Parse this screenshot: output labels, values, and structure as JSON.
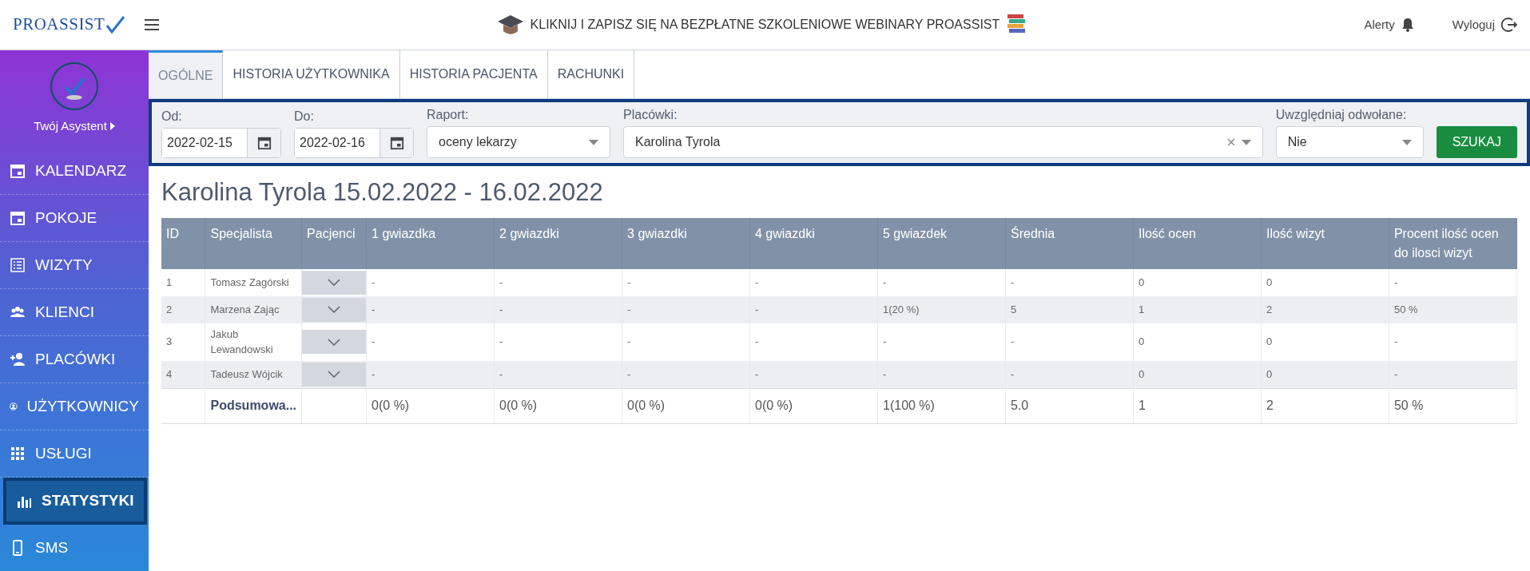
{
  "header": {
    "logo": "PROASSIST",
    "banner": "KLIKNIJ I ZAPISZ SIĘ NA BEZPŁATNE SZKOLENIOWE WEBINARY PROASSIST",
    "alerts": "Alerty",
    "logout": "Wyloguj"
  },
  "sidebar": {
    "user": "Twój Asystent",
    "items": [
      {
        "label": "KALENDARZ",
        "selected": false
      },
      {
        "label": "POKOJE",
        "selected": false
      },
      {
        "label": "WIZYTY",
        "selected": false
      },
      {
        "label": "KLIENCI",
        "selected": false
      },
      {
        "label": "PLACÓWKI",
        "selected": false
      },
      {
        "label": "UŻYTKOWNICY",
        "selected": false
      },
      {
        "label": "USŁUGI",
        "selected": false
      },
      {
        "label": "STATYSTYKI",
        "selected": true
      },
      {
        "label": "SMS",
        "selected": false
      }
    ]
  },
  "tabs": [
    {
      "label": "OGÓLNE",
      "selected": true
    },
    {
      "label": "HISTORIA UŻYTKOWNIKA",
      "selected": false
    },
    {
      "label": "HISTORIA PACJENTA",
      "selected": false
    },
    {
      "label": "RACHUNKI",
      "selected": false
    }
  ],
  "filters": {
    "from": {
      "label": "Od:",
      "value": "2022-02-15"
    },
    "to": {
      "label": "Do:",
      "value": "2022-02-16"
    },
    "report": {
      "label": "Raport:",
      "value": "oceny lekarzy"
    },
    "places": {
      "label": "Placówki:",
      "value": "Karolina Tyrola"
    },
    "cancelled": {
      "label": "Uwzględniaj odwołane:",
      "value": "Nie"
    },
    "search_button": "SZUKAJ"
  },
  "title": "Karolina Tyrola 15.02.2022 - 16.02.2022",
  "table": {
    "columns": [
      "ID",
      "Specjalista",
      "Pacjenci",
      "1 gwiazdka",
      "2 gwiazdki",
      "3 gwiazdki",
      "4 gwiazdki",
      "5 gwiazdek",
      "Średnia",
      "Ilość ocen",
      "Ilość wizyt",
      "Procent ilość ocen do ilosci wizyt"
    ],
    "rows": [
      {
        "cells": [
          "1",
          "Tomasz Zagórski",
          "",
          "-",
          "-",
          "-",
          "-",
          "-",
          "-",
          "0",
          "0",
          "-"
        ]
      },
      {
        "cells": [
          "2",
          "Marzena Zając",
          "",
          "-",
          "-",
          "-",
          "-",
          "1(20 %)",
          "5",
          "1",
          "2",
          "50 %"
        ]
      },
      {
        "cells": [
          "3",
          "Jakub Lewandowski",
          "",
          "-",
          "-",
          "-",
          "-",
          "-",
          "-",
          "0",
          "0",
          "-"
        ]
      },
      {
        "cells": [
          "4",
          "Tadeusz Wójcik",
          "",
          "-",
          "-",
          "-",
          "-",
          "-",
          "-",
          "0",
          "0",
          "-"
        ]
      }
    ],
    "summary": {
      "cells": [
        "",
        "Podsumowa...",
        "",
        "0(0 %)",
        "0(0 %)",
        "0(0 %)",
        "0(0 %)",
        "1(100 %)",
        "5.0",
        "1",
        "2",
        "50 %"
      ]
    }
  }
}
